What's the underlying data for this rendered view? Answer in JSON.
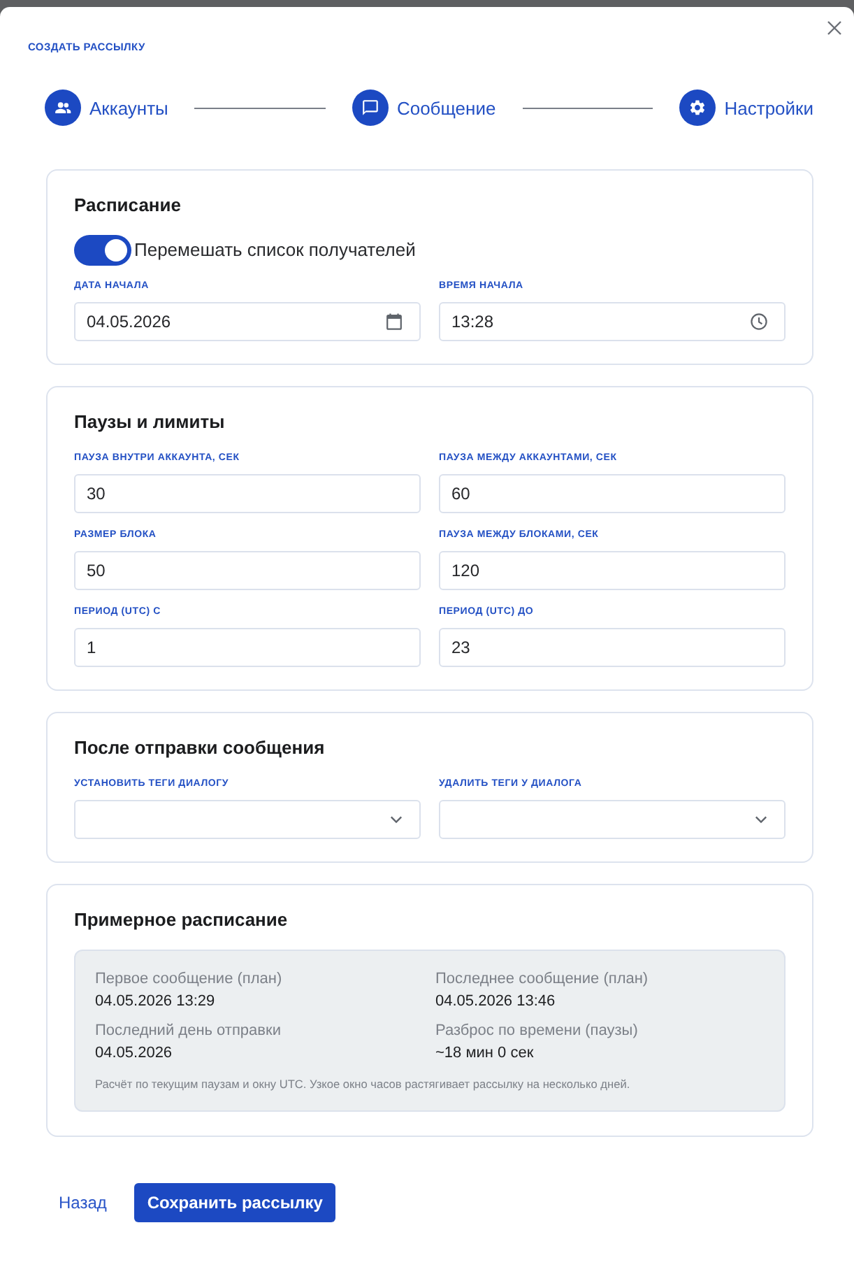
{
  "dialog": {
    "title": "СОЗДАТЬ РАССЫЛКУ"
  },
  "steps": [
    {
      "label": "Аккаунты",
      "kind": "accounts"
    },
    {
      "label": "Сообщение",
      "kind": "message"
    },
    {
      "label": "Настройки",
      "kind": "settings"
    }
  ],
  "sections": [
    {
      "title": "Расписание",
      "toggle": {
        "label": "Перемешать список получателей",
        "on": true
      },
      "fields": [
        {
          "label": "ДАТА НАЧАЛА",
          "value": "04.05.2026",
          "kind": "date"
        },
        {
          "label": "ВРЕМЯ НАЧАЛА",
          "value": "13:28",
          "kind": "time"
        }
      ]
    },
    {
      "title": "Паузы и лимиты",
      "fields": [
        {
          "label": "ПАУЗА ВНУТРИ АККАУНТА, СЕК",
          "value": "30",
          "kind": "text"
        },
        {
          "label": "ПАУЗА МЕЖДУ АККАУНТАМИ, СЕК",
          "value": "60",
          "kind": "text"
        },
        {
          "label": "РАЗМЕР БЛОКА",
          "value": "50",
          "kind": "text"
        },
        {
          "label": "ПАУЗА МЕЖДУ БЛОКАМИ, СЕК",
          "value": "120",
          "kind": "text"
        },
        {
          "label": "ПЕРИОД (UTC) С",
          "value": "1",
          "kind": "text"
        },
        {
          "label": "ПЕРИОД (UTC) ДО",
          "value": "23",
          "kind": "text"
        }
      ]
    },
    {
      "title": "После отправки сообщения",
      "fields": [
        {
          "label": "УСТАНОВИТЬ ТЕГИ ДИАЛОГУ",
          "kind": "select"
        },
        {
          "label": "УДАЛИТЬ ТЕГИ У ДИАЛОГА",
          "kind": "select"
        }
      ]
    },
    {
      "title": "Примерное расписание",
      "summary": {
        "items": [
          {
            "label": "Первое сообщение (план)",
            "value": "04.05.2026 13:29"
          },
          {
            "label": "Последнее сообщение (план)",
            "value": "04.05.2026 13:46"
          },
          {
            "label": "Последний день отправки",
            "value": "04.05.2026"
          },
          {
            "label": "Разброс по времени (паузы)",
            "value": "~18 мин 0 сек"
          }
        ],
        "note": "Расчёт по текущим паузам и окну UTC. Узкое окно часов растягивает рассылку на несколько дней."
      }
    }
  ],
  "footer": {
    "back": "Назад",
    "save": "Сохранить рассылку"
  }
}
